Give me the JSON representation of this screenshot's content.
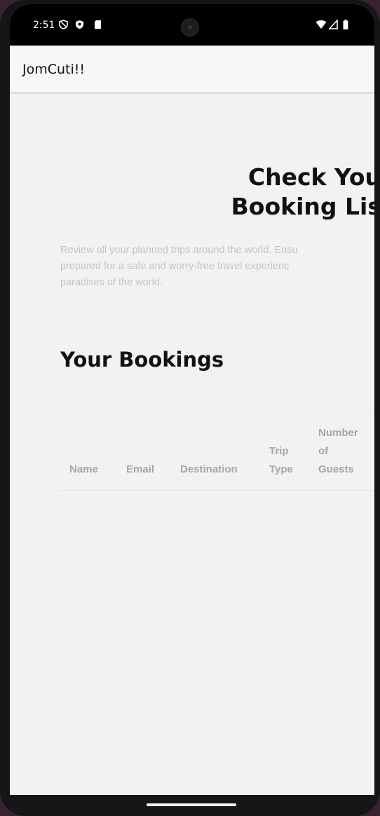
{
  "status_bar": {
    "time": "2:51",
    "icons": [
      "vpn-shield-icon",
      "security-shield-icon",
      "sd-card-icon",
      "wifi-icon",
      "signal-icon",
      "battery-icon"
    ]
  },
  "app_bar": {
    "title": "JomCuti!!"
  },
  "hero": {
    "title_line1": "Check You",
    "title_line2": "Booking Lis",
    "description": "Review all your planned trips around the world. Ensu\nprepared for a safe and worry-free travel experienc\nparadises of the world."
  },
  "bookings": {
    "section_title": "Your Bookings",
    "columns": [
      "Name",
      "Email",
      "Destination",
      "Trip\nType",
      "Number\nof\nGuests"
    ],
    "rows": []
  }
}
